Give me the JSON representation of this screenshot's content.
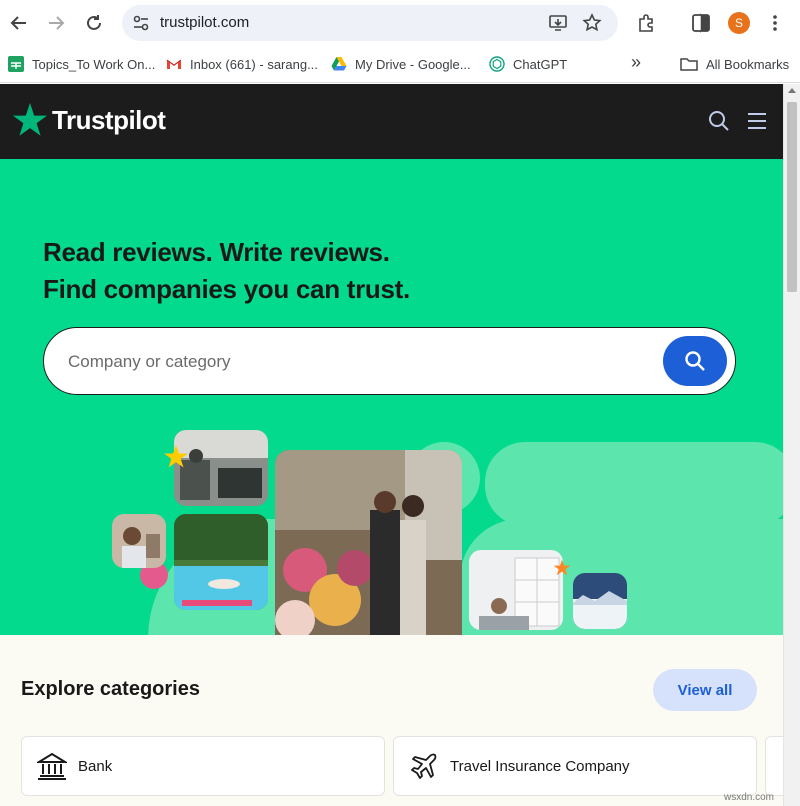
{
  "browser": {
    "url": "trustpilot.com",
    "profile_initial": "S",
    "bookmarks": [
      {
        "label": "Topics_To Work On...",
        "icon": "sheets-icon"
      },
      {
        "label": "Inbox (661) - sarang...",
        "icon": "gmail-icon"
      },
      {
        "label": "My Drive - Google...",
        "icon": "drive-icon"
      },
      {
        "label": "ChatGPT",
        "icon": "chatgpt-icon"
      }
    ],
    "overflow_label": "»",
    "all_bookmarks": "All Bookmarks"
  },
  "site": {
    "brand": "Trustpilot",
    "hero": {
      "line1": "Read reviews. Write reviews.",
      "line2": "Find companies you can trust."
    },
    "search": {
      "placeholder": "Company or category"
    },
    "explore": {
      "title": "Explore categories",
      "view_all": "View all",
      "categories": [
        {
          "label": "Bank",
          "icon": "bank-icon"
        },
        {
          "label": "Travel Insurance Company",
          "icon": "airplane-icon"
        }
      ]
    }
  },
  "watermark": "wsxdn.com",
  "colors": {
    "brand_green": "#04da8d",
    "header_dark": "#1c1c1c",
    "accent_blue": "#1c5fd6",
    "star_green": "#00b67a"
  }
}
